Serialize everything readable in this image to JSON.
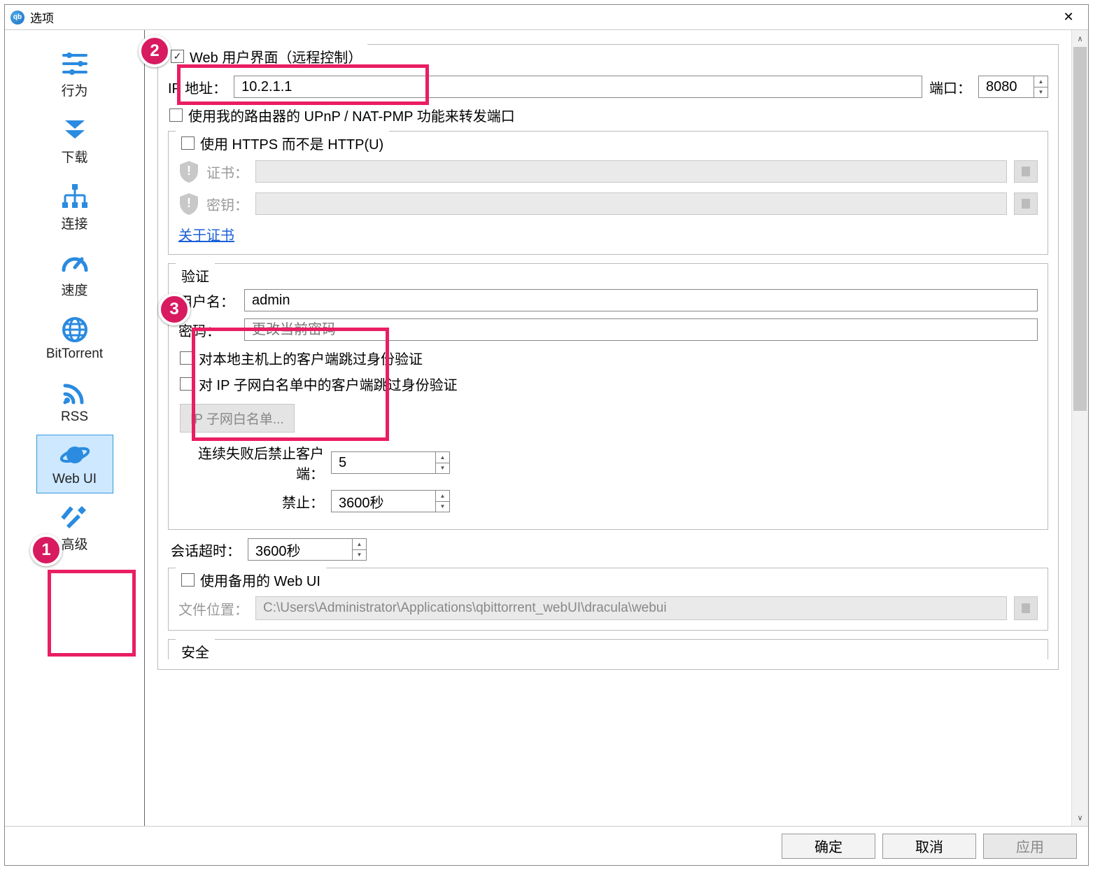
{
  "window": {
    "title": "选项"
  },
  "sidebar": {
    "items": [
      {
        "label": "行为"
      },
      {
        "label": "下载"
      },
      {
        "label": "连接"
      },
      {
        "label": "速度"
      },
      {
        "label": "BitTorrent"
      },
      {
        "label": "RSS"
      },
      {
        "label": "Web UI"
      },
      {
        "label": "高级"
      }
    ]
  },
  "webui": {
    "enable_label": "Web 用户界面（远程控制）",
    "ip_label": "IP 地址：",
    "ip_value": "10.2.1.1",
    "port_label": "端口：",
    "port_value": "8080",
    "upnp_label": "使用我的路由器的 UPnP / NAT-PMP 功能来转发端口",
    "https": {
      "enable_label": "使用 HTTPS 而不是 HTTP(U)",
      "cert_label": "证书：",
      "key_label": "密钥：",
      "about_link": "关于证书"
    },
    "auth": {
      "title": "验证",
      "user_label": "用户名：",
      "user_value": "admin",
      "pass_label": "密码：",
      "pass_placeholder": "更改当前密码",
      "bypass_local": "对本地主机上的客户端跳过身份验证",
      "bypass_whitelist": "对 IP 子网白名单中的客户端跳过身份验证",
      "whitelist_btn": "IP 子网白名单...",
      "ban_after_label": "连续失败后禁止客户端：",
      "ban_after_value": "5",
      "ban_dur_label": "禁止：",
      "ban_dur_value": "3600秒",
      "session_label": "会话超时：",
      "session_value": "3600秒"
    },
    "altui": {
      "enable_label": "使用备用的 Web UI",
      "loc_label": "文件位置：",
      "loc_value": "C:\\Users\\Administrator\\Applications\\qbittorrent_webUI\\dracula\\webui"
    },
    "security_title": "安全"
  },
  "footer": {
    "ok": "确定",
    "cancel": "取消",
    "apply": "应用"
  },
  "annotations": {
    "a1": "1",
    "a2": "2",
    "a3": "3"
  }
}
